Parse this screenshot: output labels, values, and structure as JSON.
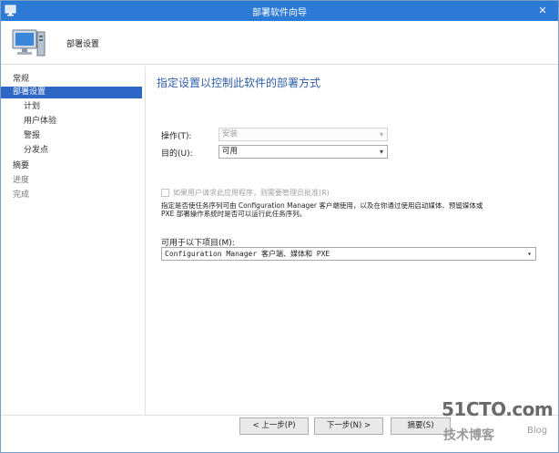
{
  "window": {
    "title": "部署软件向导",
    "close_glyph": "✕"
  },
  "header": {
    "title": "部署设置"
  },
  "sidebar": {
    "items": [
      {
        "label": "常规",
        "level": 0,
        "state": "normal"
      },
      {
        "label": "部署设置",
        "level": 0,
        "state": "active"
      },
      {
        "label": "计划",
        "level": 1,
        "state": "normal"
      },
      {
        "label": "用户体验",
        "level": 1,
        "state": "normal"
      },
      {
        "label": "警报",
        "level": 1,
        "state": "normal"
      },
      {
        "label": "分发点",
        "level": 1,
        "state": "normal"
      },
      {
        "label": "摘要",
        "level": 0,
        "state": "normal"
      },
      {
        "label": "进度",
        "level": 0,
        "state": "muted"
      },
      {
        "label": "完成",
        "level": 0,
        "state": "muted"
      }
    ]
  },
  "main": {
    "heading": "指定设置以控制此软件的部署方式",
    "action": {
      "label": "操作(T):",
      "value": "安装",
      "enabled": false
    },
    "purpose": {
      "label": "目的(U):",
      "value": "可用",
      "enabled": true
    },
    "approval_checkbox": {
      "label": "如果用户请求此应用程序，则需要管理员批准(R)",
      "checked": false,
      "enabled": false
    },
    "description_line1": "指定是否使任务序列可由 Configuration Manager 客户端使用，以及在你通过使用启动媒体、预留媒体或",
    "description_line2": "PXE 部署操作系统时是否可以运行此任务序列。",
    "available_to": {
      "label": "可用于以下项目(M):",
      "value": "Configuration Manager 客户端、媒体和 PXE"
    }
  },
  "footer": {
    "prev_label": "< 上一步(P)",
    "next_label": "下一步(N) >",
    "summary_label": "摘要(S)"
  },
  "watermark": {
    "brand": "51CTO.com",
    "sub": "技术博客",
    "blog": "Blog"
  },
  "colors": {
    "titlebar": "#2d7ad6",
    "active_nav": "#2e67c5",
    "heading": "#2f5fa8"
  }
}
